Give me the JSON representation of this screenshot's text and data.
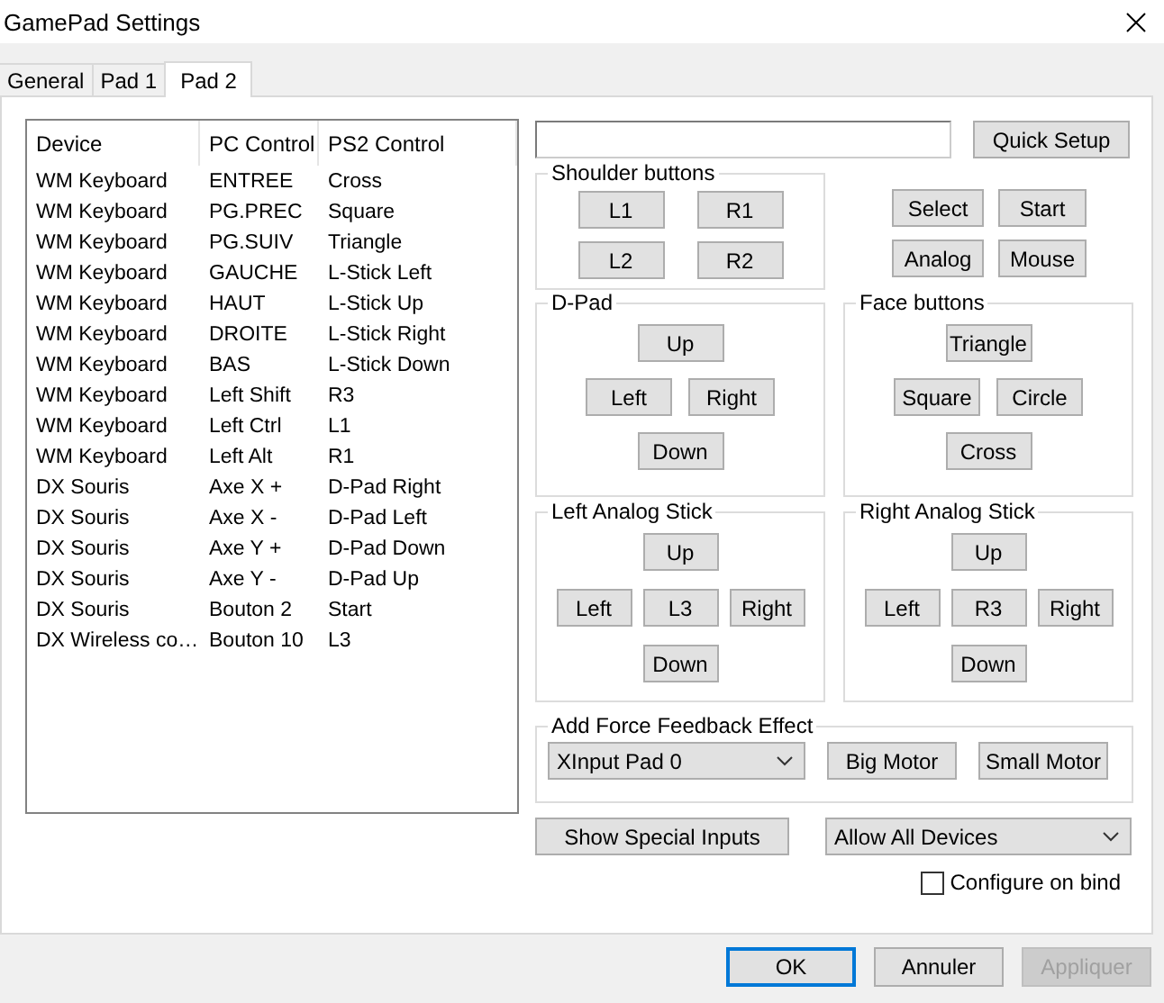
{
  "window": {
    "title": "GamePad Settings"
  },
  "tabs": [
    {
      "label": "General",
      "selected": false
    },
    {
      "label": "Pad 1",
      "selected": false
    },
    {
      "label": "Pad 2",
      "selected": true
    }
  ],
  "bindings": {
    "columns": [
      "Device",
      "PC Control",
      "PS2 Control"
    ],
    "rows": [
      [
        "WM Keyboard",
        "ENTREE",
        "Cross"
      ],
      [
        "WM Keyboard",
        "PG.PREC",
        "Square"
      ],
      [
        "WM Keyboard",
        "PG.SUIV",
        "Triangle"
      ],
      [
        "WM Keyboard",
        "GAUCHE",
        "L-Stick Left"
      ],
      [
        "WM Keyboard",
        "HAUT",
        "L-Stick Up"
      ],
      [
        "WM Keyboard",
        "DROITE",
        "L-Stick Right"
      ],
      [
        "WM Keyboard",
        "BAS",
        "L-Stick Down"
      ],
      [
        "WM Keyboard",
        "Left Shift",
        "R3"
      ],
      [
        "WM Keyboard",
        "Left Ctrl",
        "L1"
      ],
      [
        "WM Keyboard",
        "Left Alt",
        "R1"
      ],
      [
        "DX Souris",
        "Axe X +",
        "D-Pad Right"
      ],
      [
        "DX Souris",
        "Axe X -",
        "D-Pad Left"
      ],
      [
        "DX Souris",
        "Axe Y +",
        "D-Pad Down"
      ],
      [
        "DX Souris",
        "Axe Y -",
        "D-Pad Up"
      ],
      [
        "DX Souris",
        "Bouton 2",
        "Start"
      ],
      [
        "DX Wireless co…",
        "Bouton 10",
        "L3"
      ]
    ]
  },
  "quick_setup": "Quick Setup",
  "shoulder": {
    "title": "Shoulder buttons",
    "buttons": [
      "L1",
      "R1",
      "L2",
      "R2"
    ]
  },
  "system_buttons": [
    "Select",
    "Start",
    "Analog",
    "Mouse"
  ],
  "dpad": {
    "title": "D-Pad",
    "up": "Up",
    "left": "Left",
    "right": "Right",
    "down": "Down"
  },
  "face": {
    "title": "Face buttons",
    "up": "Triangle",
    "left": "Square",
    "right": "Circle",
    "down": "Cross"
  },
  "left_stick": {
    "title": "Left Analog Stick",
    "up": "Up",
    "left": "Left",
    "center": "L3",
    "right": "Right",
    "down": "Down"
  },
  "right_stick": {
    "title": "Right Analog Stick",
    "up": "Up",
    "left": "Left",
    "center": "R3",
    "right": "Right",
    "down": "Down"
  },
  "force_feedback": {
    "title": "Add Force Feedback Effect",
    "device": "XInput Pad 0",
    "buttons": [
      "Big Motor",
      "Small Motor"
    ]
  },
  "special_inputs": "Show Special Inputs",
  "device_filter": "Allow All Devices",
  "configure_on_bind": {
    "label": "Configure on bind",
    "checked": false
  },
  "footer_buttons": [
    {
      "label": "OK",
      "focused": true,
      "disabled": false
    },
    {
      "label": "Annuler",
      "focused": false,
      "disabled": false
    },
    {
      "label": "Appliquer",
      "focused": false,
      "disabled": true
    }
  ]
}
